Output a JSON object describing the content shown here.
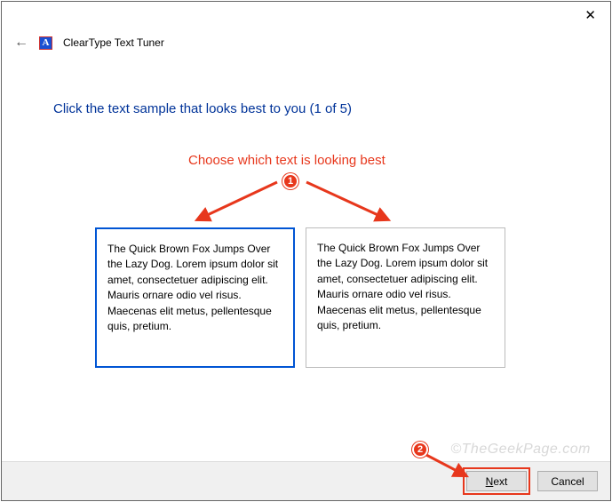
{
  "window": {
    "title": "ClearType Text Tuner",
    "close_symbol": "✕"
  },
  "instruction": "Click the text sample that looks best to you (1 of 5)",
  "annotation": {
    "text": "Choose which text is looking best",
    "badge1": "1",
    "badge2": "2"
  },
  "samples": {
    "left": "The Quick Brown Fox Jumps Over the Lazy Dog. Lorem ipsum dolor sit amet, consectetuer adipiscing elit. Mauris ornare odio vel risus. Maecenas elit metus, pellentesque quis, pretium.",
    "right": "The Quick Brown Fox Jumps Over the Lazy Dog. Lorem ipsum dolor sit amet, consectetuer adipiscing elit. Mauris ornare odio vel risus. Maecenas elit metus, pellentesque quis, pretium."
  },
  "footer": {
    "next_prefix": "N",
    "next_rest": "ext",
    "cancel": "Cancel"
  },
  "watermark": "©TheGeekPage.com"
}
